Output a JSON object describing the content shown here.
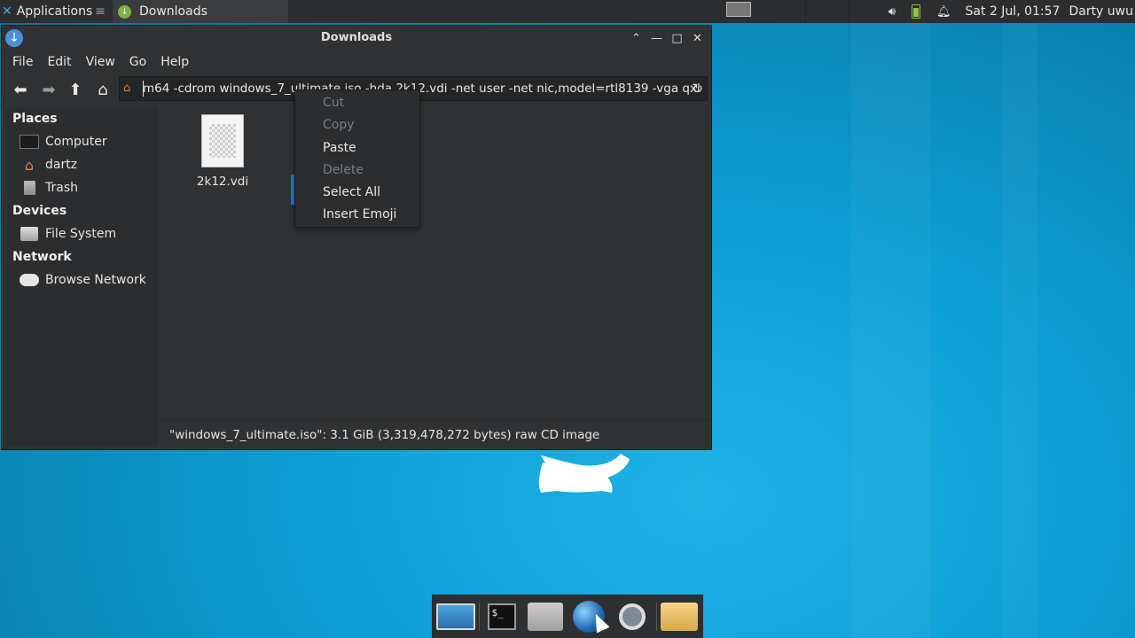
{
  "top_panel": {
    "applications_label": "Applications",
    "task_label": "Downloads",
    "datetime": "Sat  2 Jul, 01:57",
    "user": "Darty uwu"
  },
  "window": {
    "title": "Downloads",
    "menu": [
      "File",
      "Edit",
      "View",
      "Go",
      "Help"
    ],
    "location": "m64 -cdrom windows_7_ultimate.iso -hda 2k12.vdi -net user -net nic,model=rtl8139 -vga qxl",
    "sidebar": {
      "places_label": "Places",
      "places": [
        "Computer",
        "dartz",
        "Trash"
      ],
      "devices_label": "Devices",
      "devices": [
        "File System"
      ],
      "network_label": "Network",
      "network": [
        "Browse Network"
      ]
    },
    "files": [
      {
        "name": "2k12.vdi"
      }
    ],
    "status": "\"windows_7_ultimate.iso\": 3.1 GiB (3,319,478,272 bytes) raw CD image"
  },
  "context_menu": {
    "items": [
      {
        "label": "Cut",
        "enabled": false
      },
      {
        "label": "Copy",
        "enabled": false
      },
      {
        "label": "Paste",
        "enabled": true
      },
      {
        "label": "Delete",
        "enabled": false
      },
      {
        "label": "Select All",
        "enabled": true
      },
      {
        "label": "Insert Emoji",
        "enabled": true
      }
    ]
  },
  "dock": {
    "items": [
      "desktop-icon",
      "terminal-icon",
      "home-folder-icon",
      "web-browser-icon",
      "search-icon",
      "file-manager-icon"
    ]
  },
  "colors": {
    "accent": "#2a6fd6",
    "desktop": "#0da0d6"
  }
}
